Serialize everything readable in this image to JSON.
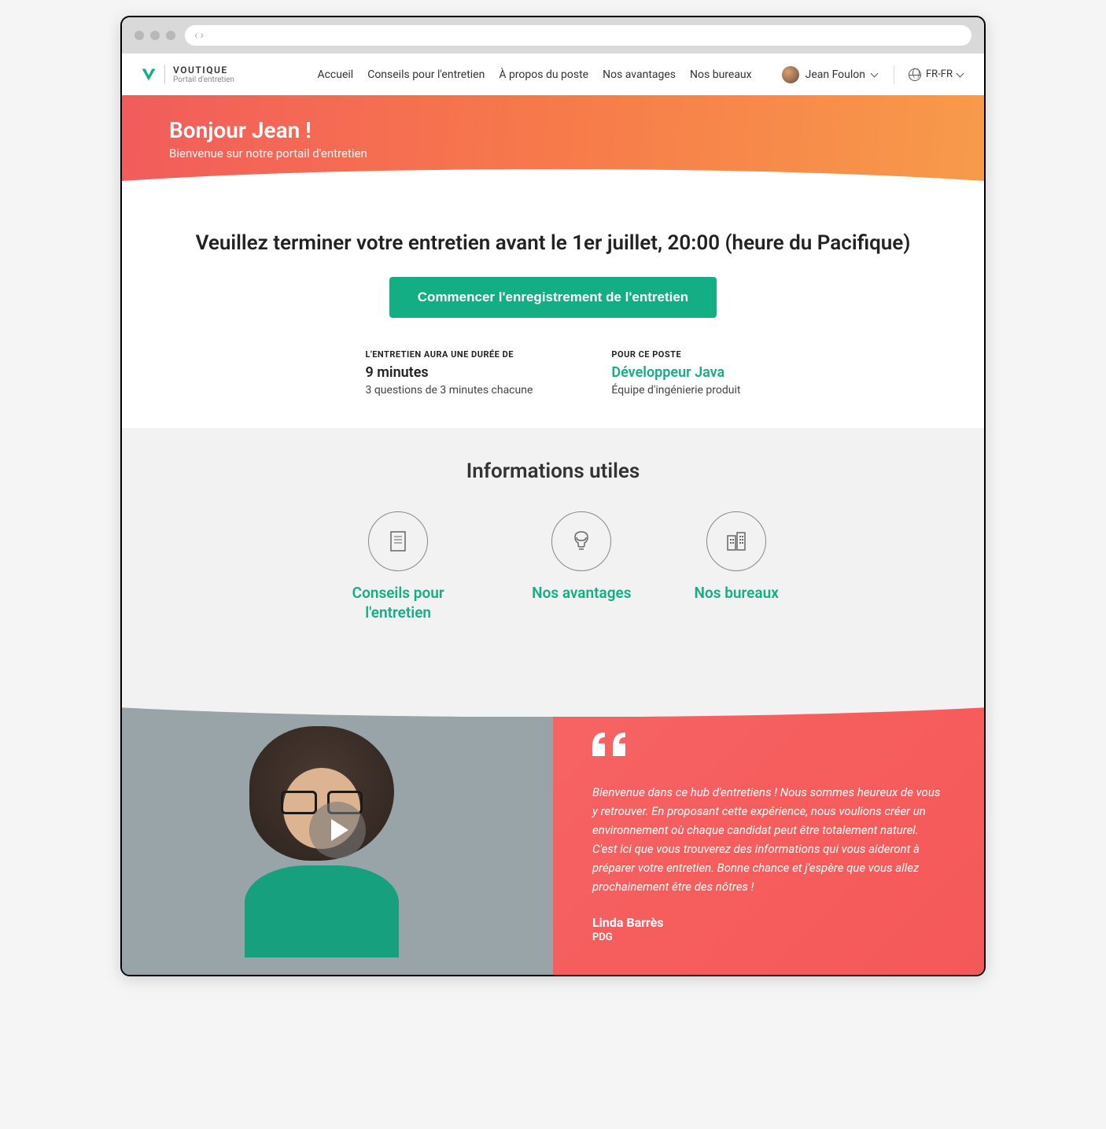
{
  "browser": {
    "nav_arrows": "‹ ›"
  },
  "brand": {
    "title": "VOUTIQUE",
    "subtitle": "Portail d'entretien"
  },
  "nav": {
    "items": [
      "Accueil",
      "Conseils pour l'entretien",
      "À propos du poste",
      "Nos avantages",
      "Nos bureaux"
    ]
  },
  "user": {
    "name": "Jean Foulon"
  },
  "locale": {
    "label": "FR-FR"
  },
  "hero": {
    "greeting": "Bonjour Jean !",
    "subtitle": "Bienvenue sur notre portail d'entretien"
  },
  "cta": {
    "deadline": "Veuillez terminer votre entretien avant le 1er juillet, 20:00 (heure du Pacifique)",
    "button": "Commencer l'enregistrement de l'entretien"
  },
  "details": {
    "duration_label": "L'ENTRETIEN AURA UNE DURÉE DE",
    "duration_value": "9 minutes",
    "duration_sub": "3 questions de 3 minutes chacune",
    "position_label": "POUR CE POSTE",
    "position_value": "Développeur Java",
    "position_sub": "Équipe d'ingénierie produit"
  },
  "info": {
    "title": "Informations utiles",
    "tiles": [
      {
        "label": "Conseils pour l'entretien"
      },
      {
        "label": "Nos avantages"
      },
      {
        "label": "Nos bureaux"
      }
    ]
  },
  "testimonial": {
    "quote": "Bienvenue dans ce hub d'entretiens ! Nous sommes heureux de vous y retrouver. En proposant cette expérience, nous voulions créer un environnement où chaque candidat peut être totalement naturel. C'est ici que vous trouverez des informations qui vous aideront à préparer votre entretien. Bonne chance et j'espère que vous allez prochainement être des nôtres !",
    "author_name": "Linda Barrès",
    "author_role": "PDG"
  }
}
